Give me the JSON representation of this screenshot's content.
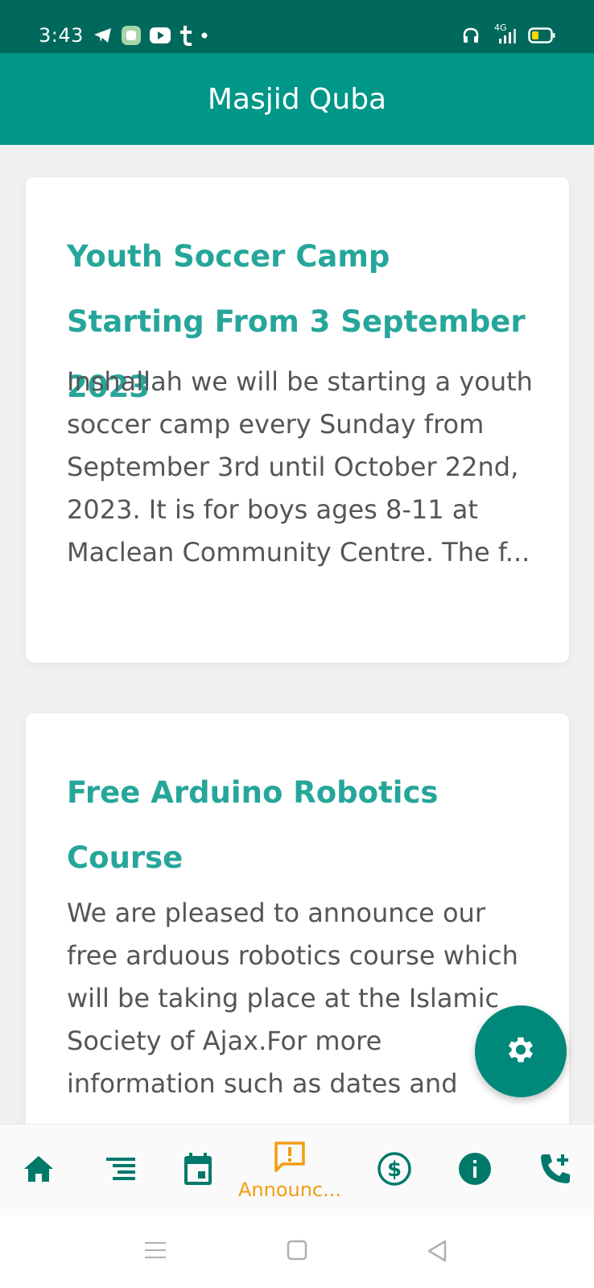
{
  "status_bar": {
    "time": "3:43",
    "network": "4G"
  },
  "app_bar": {
    "title": "Masjid Quba"
  },
  "announcements": [
    {
      "title": "Youth Soccer Camp Starting From 3 September 2023",
      "body": "Inshallah we will be starting a youth soccer camp every Sunday from September 3rd until October 22nd, 2023. It is for boys ages 8-11 at Maclean Community Centre. The f..."
    },
    {
      "title": "Free Arduino Robotics Course",
      "body": "We are pleased to announce our free arduous robotics course which will be taking place at the Islamic Society of Ajax.For more information such as dates and"
    }
  ],
  "bottom_nav": {
    "items": [
      {
        "icon": "home-icon"
      },
      {
        "icon": "list-icon"
      },
      {
        "icon": "calendar-icon"
      },
      {
        "icon": "announcement-icon",
        "label": "Announc...",
        "active": true
      },
      {
        "icon": "dollar-icon"
      },
      {
        "icon": "info-icon"
      },
      {
        "icon": "phone-add-icon"
      }
    ]
  },
  "colors": {
    "primary": "#009688",
    "primary_dark": "#00695c",
    "accent": "#f39c12",
    "title_teal": "#26a69a",
    "nav_icon": "#00796b"
  }
}
